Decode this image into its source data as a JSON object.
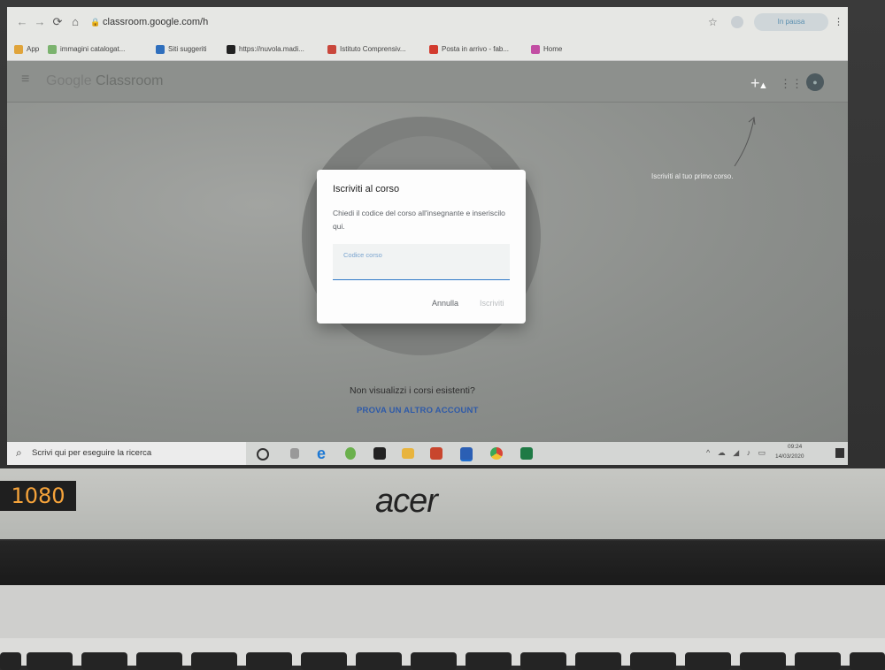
{
  "browser": {
    "url": "classroom.google.com/h",
    "profile": "In pausa",
    "bookmarks": [
      {
        "label": "App",
        "color": "#e0a43a"
      },
      {
        "label": "immagini catalogat...",
        "color": "#7bb36e"
      },
      {
        "label": "Siti suggeriti",
        "color": "#2f6fbd"
      },
      {
        "label": "https://nuvola.madi...",
        "color": "#222222"
      },
      {
        "label": "Istituto Comprensiv...",
        "color": "#c9473b"
      },
      {
        "label": "Posta in arrivo - fab...",
        "color": "#d23b2e"
      },
      {
        "label": "Home",
        "color": "#c24ea3"
      }
    ]
  },
  "app": {
    "brand_google": "Google",
    "brand_classroom": "Classroom",
    "hint": "Iscriviti al tuo primo corso.",
    "no_courses": "Non visualizzi i corsi esistenti?",
    "other_account": "PROVA UN ALTRO ACCOUNT"
  },
  "dialog": {
    "title": "Iscriviti al corso",
    "text": "Chiedi il codice del corso all'insegnante e inseriscilo qui.",
    "code_placeholder": "Codice corso",
    "cancel": "Annulla",
    "join": "Iscriviti"
  },
  "taskbar": {
    "search": "Scrivi qui per eseguire la ricerca",
    "time": "09:24",
    "date": "14/03/2020",
    "apps": [
      "cortana-icon",
      "task-view-icon",
      "edge-icon",
      "green-app-icon",
      "store-icon",
      "explorer-icon",
      "powerpoint-icon",
      "word-icon",
      "chrome-icon",
      "excel-icon"
    ]
  },
  "laptop": {
    "resolution_label": "1080",
    "brand": "acer"
  }
}
